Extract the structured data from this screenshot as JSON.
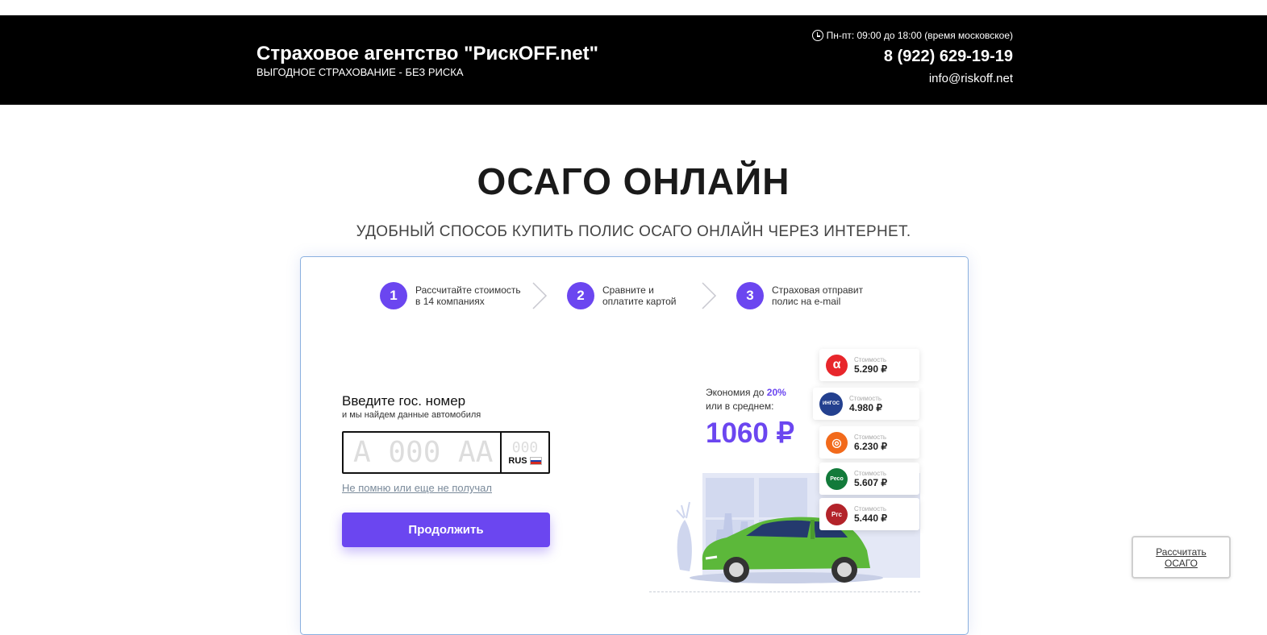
{
  "header": {
    "title": "Страховое агентство \"РискOFF.net\"",
    "subtitle": "ВЫГОДНОЕ СТРАХОВАНИЕ - БЕЗ РИСКА",
    "hours": "Пн-пт: 09:00 до 18:00 (время московское)",
    "phone": "8 (922) 629-19-19",
    "email": "info@riskoff.net"
  },
  "main": {
    "title": "ОСАГО ОНЛАЙН",
    "subtitle": "УДОБНЫЙ СПОСОБ КУПИТЬ ПОЛИС ОСАГО ОНЛАЙН ЧЕРЕЗ ИНТЕРНЕТ."
  },
  "steps": [
    {
      "num": "1",
      "line1": "Рассчитайте стоимость",
      "line2": "в 14 компаниях"
    },
    {
      "num": "2",
      "line1": "Сравните и",
      "line2": "оплатите картой"
    },
    {
      "num": "3",
      "line1": "Страховая отправит",
      "line2": "полис на e-mail"
    }
  ],
  "form": {
    "title": "Введите гос. номер",
    "hint": "и мы найдем данные автомобиля",
    "plate_placeholder": "А 000 АА",
    "region_placeholder": "000",
    "country": "RUS",
    "no_plate_link": "Не помню или еще не получал",
    "continue_button": "Продолжить"
  },
  "savings": {
    "line1_prefix": "Экономия до ",
    "percent": "20%",
    "line2": "или в среднем:",
    "amount": "1060 ₽"
  },
  "offers": [
    {
      "logo": "α",
      "color": "#e8262b",
      "label": "Стоимость",
      "price": "5.290 ₽"
    },
    {
      "logo": "ИНГОС",
      "color": "#23408f",
      "label": "Стоимость",
      "price": "4.980 ₽"
    },
    {
      "logo": "◎",
      "color": "#f26a1b",
      "label": "Стоимость",
      "price": "6.230 ₽"
    },
    {
      "logo": "Ресо",
      "color": "#127a3a",
      "label": "Стоимость",
      "price": "5.607 ₽"
    },
    {
      "logo": "Ргс",
      "color": "#b3232a",
      "label": "Стоимость",
      "price": "5.440 ₽"
    }
  ],
  "floating": {
    "calc_line1": "Рассчитать",
    "calc_line2": "ОСАГО"
  },
  "colors": {
    "accent": "#6b46f0",
    "header_bg": "#000000",
    "card_border": "#8ab0df",
    "car": "#5cb83a"
  }
}
